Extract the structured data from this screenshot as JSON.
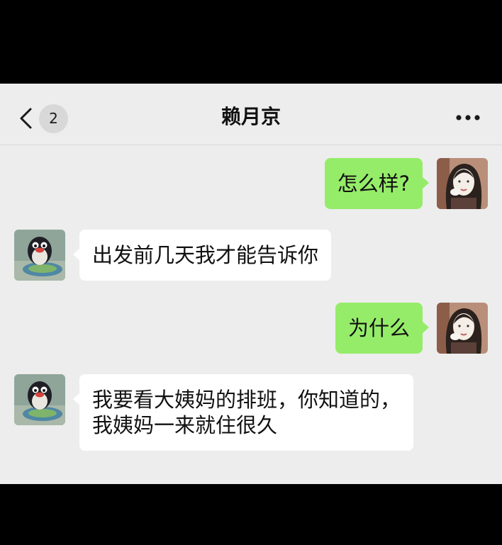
{
  "header": {
    "back_icon": "chevron-left-icon",
    "unread_count": "2",
    "title": "赖月京",
    "more_icon": "more-dots-icon"
  },
  "messages": [
    {
      "side": "out",
      "lines": [
        "怎么样?"
      ]
    },
    {
      "side": "in",
      "lines": [
        "出发前几天我才能告诉你"
      ]
    },
    {
      "side": "out",
      "lines": [
        "为什么"
      ]
    },
    {
      "side": "in",
      "lines": [
        "我要看大姨妈的排班，你知道的，",
        "我姨妈一来就住很久"
      ]
    }
  ],
  "colors": {
    "background": "#ededed",
    "outgoing_bubble": "#95ec69",
    "incoming_bubble": "#ffffff"
  }
}
